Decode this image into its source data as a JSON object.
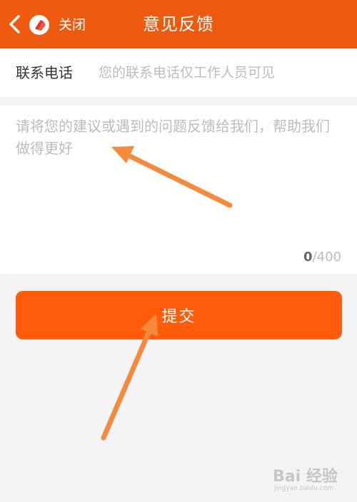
{
  "header": {
    "title": "意见反馈",
    "close_label": "关闭",
    "accent_color": "#ee5a10"
  },
  "contact": {
    "label": "联系电话",
    "value": "",
    "placeholder": "您的联系电话仅工作人员可见"
  },
  "feedback": {
    "value": "",
    "placeholder": "请将您的建议或遇到的问题反馈给我们，帮助我们做得更好",
    "char_count": "0",
    "char_limit": "/400"
  },
  "submit_label": "提交",
  "annotation": {
    "arrow_color": "#f58a3c"
  },
  "watermark": {
    "brand": "Bai 经验",
    "url": "jingyan.baidu.com"
  }
}
